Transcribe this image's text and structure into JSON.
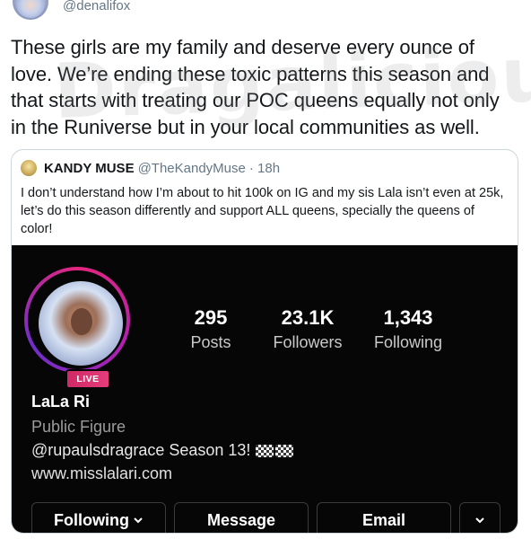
{
  "tweet": {
    "handle": "@denalifox",
    "text": "These girls are my family and deserve every ounce of love. We’re ending these toxic patterns this season and that starts with treating our POC queens equally not only in the Runiverse but in your local communities as well."
  },
  "watermark": {
    "text": "Dragalicious"
  },
  "quoted_tweet": {
    "name": "KANDY MUSE",
    "handle": "@TheKandyMuse",
    "time": "· 18h",
    "text": "I don’t understand how I’m about to hit 100k on IG and my sis Lala isn’t even at 25k, let’s do this season differently and support ALL queens, specially the queens of color!"
  },
  "instagram": {
    "live_label": "LIVE",
    "stats": [
      {
        "value": "295",
        "label": "Posts"
      },
      {
        "value": "23.1K",
        "label": "Followers"
      },
      {
        "value": "1,343",
        "label": "Following"
      }
    ],
    "name": "LaLa Ri",
    "category": "Public Figure",
    "bio": "@rupaulsdragrace Season 13!",
    "link": "www.misslalari.com",
    "buttons": {
      "following": "Following",
      "message": "Message",
      "email": "Email"
    },
    "chevron_glyph": "⌄"
  }
}
